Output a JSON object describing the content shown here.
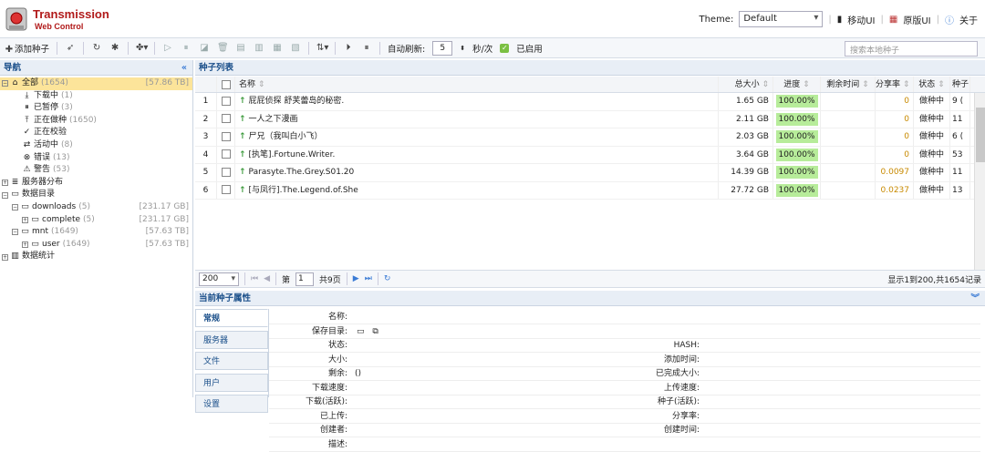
{
  "app": {
    "title": "Transmission",
    "subtitle": "Web Control"
  },
  "header": {
    "theme_label": "Theme:",
    "theme_value": "Default",
    "mobile_ui": "移动UI",
    "classic_ui": "原版UI",
    "about": "关于"
  },
  "toolbar": {
    "add_torrent": "添加种子",
    "auto_refresh_label": "自动刷新:",
    "refresh_value": "5",
    "refresh_unit": "秒/次",
    "enabled_label": "已启用",
    "search_placeholder": "搜索本地种子"
  },
  "nav": {
    "title": "导航"
  },
  "tree": [
    {
      "label": "全部",
      "count": "(1654)",
      "size": "[57.86 TB]",
      "level": 0,
      "icon": "home-icon",
      "glyph": "⌂",
      "expander": "−"
    },
    {
      "label": "下载中",
      "count": "(1)",
      "level": 1,
      "icon": "download-icon",
      "glyph": "⤓"
    },
    {
      "label": "已暂停",
      "count": "(3)",
      "level": 1,
      "icon": "pause-icon",
      "glyph": "⏸"
    },
    {
      "label": "正在做种",
      "count": "(1650)",
      "level": 1,
      "icon": "upload-icon",
      "glyph": "⤒"
    },
    {
      "label": "正在校验",
      "count": "",
      "level": 1,
      "icon": "check-icon",
      "glyph": "✓"
    },
    {
      "label": "活动中",
      "count": "(8)",
      "level": 1,
      "icon": "activity-icon",
      "glyph": "⇄"
    },
    {
      "label": "错误",
      "count": "(13)",
      "level": 1,
      "icon": "error-icon",
      "glyph": "⊗"
    },
    {
      "label": "警告",
      "count": "(53)",
      "level": 1,
      "icon": "warning-icon",
      "glyph": "⚠"
    },
    {
      "label": "服务器分布",
      "count": "",
      "level": 0,
      "icon": "server-icon",
      "glyph": "≣",
      "expander": "+"
    },
    {
      "label": "数据目录",
      "count": "",
      "level": 0,
      "icon": "folder-icon",
      "glyph": "▭",
      "expander": "−"
    },
    {
      "label": "downloads",
      "count": "(5)",
      "size": "[231.17 GB]",
      "level": 1,
      "icon": "folder-icon",
      "glyph": "▭",
      "expander": "−"
    },
    {
      "label": "complete",
      "count": "(5)",
      "size": "[231.17 GB]",
      "level": 2,
      "icon": "folder-icon",
      "glyph": "▭",
      "expander": "+"
    },
    {
      "label": "mnt",
      "count": "(1649)",
      "size": "[57.63 TB]",
      "level": 1,
      "icon": "folder-icon",
      "glyph": "▭",
      "expander": "−"
    },
    {
      "label": "user",
      "count": "(1649)",
      "size": "[57.63 TB]",
      "level": 2,
      "icon": "folder-icon",
      "glyph": "▭",
      "expander": "+"
    },
    {
      "label": "数据统计",
      "count": "",
      "level": 0,
      "icon": "stats-icon",
      "glyph": "▥",
      "expander": "+"
    }
  ],
  "list": {
    "title": "种子列表",
    "columns": {
      "name": "名称",
      "size": "总大小",
      "progress": "进度",
      "remaining": "剩余时间",
      "ratio": "分享率",
      "status": "状态",
      "seeds": "种子|"
    },
    "rows": [
      {
        "n": "1",
        "name": "屁屁侦探 舒芙蕾岛的秘密.",
        "size": "1.65 GB",
        "progress": "100.00%",
        "ratio": "0",
        "status": "做种中",
        "seeds": "9 ("
      },
      {
        "n": "2",
        "name": "一人之下漫画",
        "size": "2.11 GB",
        "progress": "100.00%",
        "ratio": "0",
        "status": "做种中",
        "seeds": "11"
      },
      {
        "n": "3",
        "name": "尸兄（我叫白小飞）",
        "size": "2.03 GB",
        "progress": "100.00%",
        "ratio": "0",
        "status": "做种中",
        "seeds": "6 ("
      },
      {
        "n": "4",
        "name": "[执笔].Fortune.Writer.",
        "size": "3.64 GB",
        "progress": "100.00%",
        "ratio": "0",
        "status": "做种中",
        "seeds": "53"
      },
      {
        "n": "5",
        "name": "Parasyte.The.Grey.S01.20",
        "size": "14.39 GB",
        "progress": "100.00%",
        "ratio": "0.0097",
        "status": "做种中",
        "seeds": "11"
      },
      {
        "n": "6",
        "name": "[与凤行].The.Legend.of.She",
        "size": "27.72 GB",
        "progress": "100.00%",
        "ratio": "0.0237",
        "status": "做种中",
        "seeds": "13"
      }
    ]
  },
  "pager": {
    "page_size": "200",
    "page_label": "第",
    "page_value": "1",
    "total_pages": "共9页",
    "info": "显示1到200,共1654记录"
  },
  "props": {
    "title": "当前种子属性",
    "tabs": [
      "常规",
      "服务器",
      "文件",
      "用户",
      "设置"
    ],
    "left_labels": [
      "名称:",
      "保存目录:",
      "状态:",
      "大小:",
      "剩余:",
      "下载速度:",
      "下载(活跃):",
      "已上传:",
      "创建者:",
      "描述:"
    ],
    "remaining_value": "()",
    "right_labels": [
      "HASH:",
      "添加时间:",
      "已完成大小:",
      "上传速度:",
      "种子(活跃):",
      "分享率:",
      "创建时间:"
    ]
  }
}
